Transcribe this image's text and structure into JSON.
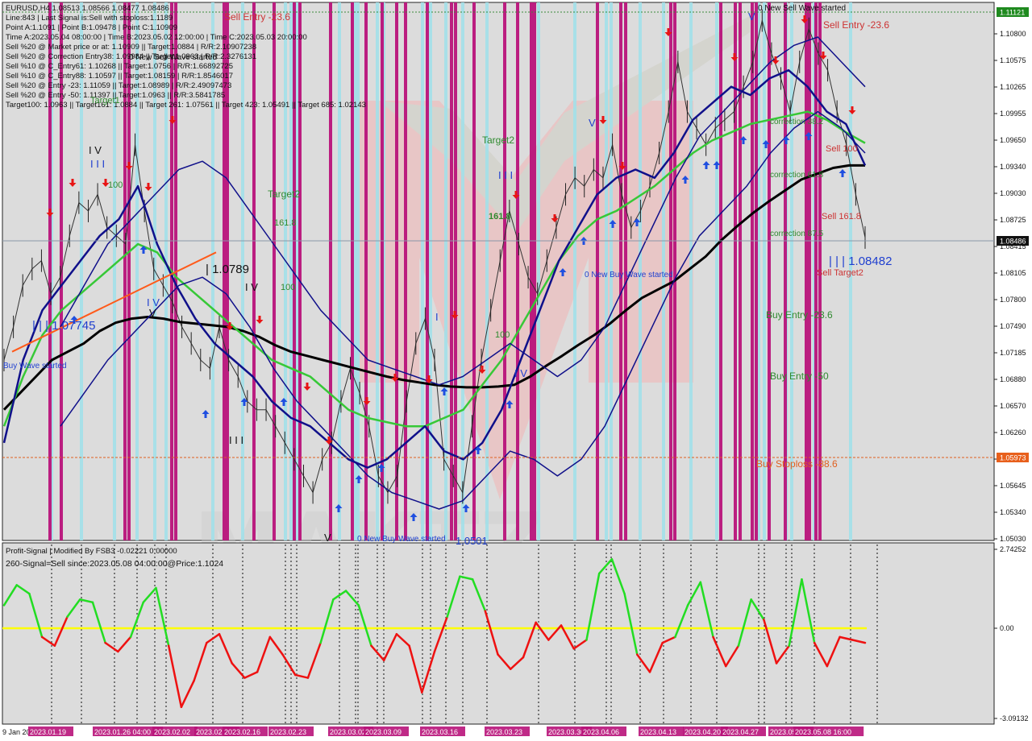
{
  "chart_data": {
    "type": "line",
    "symbol_line": "EURUSD,H4  1.08513 1.08566 1.08477 1.08486",
    "info_lines": [
      "Line:843 | Last Signal is:Sell with stoploss:1.1189",
      "Point A:1.1091 | Point B:1.09478 | Point C:1.10909",
      "Time A:2023.05.04 08:00:00 | Time B:2023.05.02 12:00:00 | Time C:2023.05.03 20:00:00",
      "Sell %20 @ Market price or at: 1.10909 || Target:1.0884 | R/R:2.10907238",
      "Sell %20 @ Correction Entry38: 1.09984 || Target:1.0963 | R/R:2.3276131",
      "Sell %10 @ C_Entry61: 1.10268 || Target:1.0756 | R/R:1.66892725",
      "Sell %10 @ C_Entry88: 1.10597 || Target:1.08159 | R/R:1.8546017",
      "Sell %20 @ Entry -23: 1.11059 || Target:1.08989 | R/R:2.49097473",
      "Sell %20 @ Entry -50: 1.11397 || Target:1.0963 || R/R:3.5841785",
      "Target100: 1.0963 || Target161: 1.0884 || Target 261: 1.07561 || Target 423: 1.05491 || Target 685: 1.02143"
    ],
    "y_ticks": [
      "1.10800",
      "1.10575",
      "1.10265",
      "1.09955",
      "1.09650",
      "1.09340",
      "1.09030",
      "1.08725",
      "1.08415",
      "1.08105",
      "1.07800",
      "1.07490",
      "1.07185",
      "1.06880",
      "1.06570",
      "1.06260",
      "1.05955",
      "1.05645",
      "1.05340",
      "1.05030"
    ],
    "ylim": [
      1.0485,
      1.1127
    ],
    "current_price": "1.08486",
    "top_price": "1.11121",
    "stop_price": "1.05973",
    "indicator": {
      "name": "Profit-Signal | Modified By FSB3 -0.02221 0.00000",
      "signal_text": "260-Signal=Sell since:2023.05.08 04:00:00@Price:1.1024",
      "y_ticks": [
        "2.74252",
        "0.00",
        "-3.09132"
      ],
      "ylim": [
        -3.09132,
        2.74252
      ]
    },
    "x_labels": [
      "9 Jan 2023",
      "2023.01.19",
      "2023.01.26 04:00",
      "2023.02.02",
      "2023.02.09",
      "2023.02.16",
      "2023.02.23",
      "2023.03.02",
      "2023.03.09",
      "2023.03.16",
      "2023.03.23",
      "2023.03.30",
      "2023.04.06",
      "2023.04.13",
      "2023.04.20",
      "2023.04.27",
      "2023.05.04",
      "2023.05.08 16:00"
    ],
    "annotations": {
      "sell_entry_top": "Sell Entry -23.6",
      "sell_entry_right": "Sell Entry -23.6",
      "new_sell_wave_top": "0 New Sell Wave started",
      "new_sell_wave_left": "0 New Sell Wave started",
      "target2_top": "Target2",
      "target2_mid": "Target2",
      "target1_left": "Target1",
      "fib_161_mid": "161.8",
      "fib_100_mid": "100",
      "fib_161_right": "161.8",
      "fib_100_right": "100",
      "fib_100_low": "100",
      "level_1_0789": "| 1.0789",
      "level_1_07745": "| | | 1.07745",
      "level_1_08482": "| | | 1.08482",
      "buy_wave_left": "Buy Wave started",
      "buy_wave_mid": "0 New Buy Wave started",
      "buy_wave_bottom": "0 New Buy Wave started",
      "price_1_0501": "1.0501",
      "correction_38": "correction 38.2",
      "correction_61": "correction 61.8",
      "correction_87": "correction 87.5",
      "sell_100": "Sell 100",
      "sell_161": "Sell 161.8",
      "sell_target2": "Sell Target2",
      "buy_entry_236": "Buy Entry -23.6",
      "buy_entry_50": "Buy Entry -50",
      "buy_stoploss": "Buy Stoploss -88.6",
      "wave_iv_a": "I V",
      "wave_iii_a": "I I I",
      "wave_iv_b": "I V",
      "wave_v_a": "V",
      "wave_iii_b": "I I I",
      "wave_iv_c": "I V",
      "wave_v_b": "V",
      "wave_i": "I",
      "wave_iv_d": "I V",
      "wave_iii_c": "I I I",
      "wave_v_c": "V",
      "wave_v_d": "V"
    },
    "series": [
      {
        "name": "price",
        "values": [
          1.07,
          1.074,
          1.079,
          1.081,
          1.082,
          1.078,
          1.08,
          1.085,
          1.089,
          1.088,
          1.09,
          1.086,
          1.085,
          1.084,
          1.096,
          1.088,
          1.081,
          1.079,
          1.077,
          1.074,
          1.072,
          1.07,
          1.069,
          1.074,
          1.07,
          1.068,
          1.065,
          1.064,
          1.064,
          1.062,
          1.06,
          1.058,
          1.056,
          1.054,
          1.058,
          1.06,
          1.065,
          1.069,
          1.066,
          1.062,
          1.056,
          1.054,
          1.056,
          1.065,
          1.072,
          1.075,
          1.07,
          1.058,
          1.056,
          1.054,
          1.062,
          1.07,
          1.076,
          1.082,
          1.088,
          1.084,
          1.08,
          1.078,
          1.082,
          1.086,
          1.09,
          1.092,
          1.091,
          1.093,
          1.092,
          1.096,
          1.09,
          1.086,
          1.088,
          1.091,
          1.095,
          1.1,
          1.106,
          1.1,
          1.098,
          1.096,
          1.098,
          1.099,
          1.1,
          1.103,
          1.106,
          1.111,
          1.107,
          1.104,
          1.1,
          1.106,
          1.11,
          1.107,
          1.105,
          1.1,
          1.096,
          1.09,
          1.0848
        ]
      },
      {
        "name": "ma_black",
        "values": [
          1.064,
          1.066,
          1.068,
          1.07,
          1.071,
          1.072,
          1.0735,
          1.0745,
          1.075,
          1.0752,
          1.075,
          1.0746,
          1.0744,
          1.0742,
          1.074,
          1.0735,
          1.0728,
          1.0718,
          1.071,
          1.0705,
          1.07,
          1.0695,
          1.069,
          1.0685,
          1.068,
          1.0676,
          1.0673,
          1.067,
          1.0668,
          1.0667,
          1.0667,
          1.0668,
          1.067,
          1.068,
          1.0693,
          1.0705,
          1.0718,
          1.073,
          1.0744,
          1.076,
          1.0775,
          1.0785,
          1.0795,
          1.081,
          1.0825,
          1.0845,
          1.0862,
          1.0878,
          1.0892,
          1.0905,
          1.0918,
          1.0925,
          1.0932,
          1.0935,
          1.0935
        ]
      },
      {
        "name": "ma_green",
        "values": [
          1.062,
          1.068,
          1.073,
          1.076,
          1.078,
          1.08,
          1.082,
          1.084,
          1.083,
          1.08,
          1.078,
          1.076,
          1.074,
          1.072,
          1.07,
          1.069,
          1.068,
          1.066,
          1.064,
          1.063,
          1.0625,
          1.062,
          1.062,
          1.063,
          1.064,
          1.067,
          1.07,
          1.074,
          1.078,
          1.082,
          1.085,
          1.087,
          1.088,
          1.0895,
          1.091,
          1.093,
          1.095,
          1.0965,
          1.0975,
          1.0985,
          1.099,
          1.0995,
          1.1,
          1.099,
          1.0975,
          1.0962
        ]
      },
      {
        "name": "ma_navy",
        "values": [
          1.06,
          1.07,
          1.076,
          1.079,
          1.082,
          1.085,
          1.087,
          1.091,
          1.084,
          1.079,
          1.075,
          1.072,
          1.07,
          1.068,
          1.065,
          1.063,
          1.062,
          1.06,
          1.058,
          1.057,
          1.058,
          1.06,
          1.062,
          1.059,
          1.058,
          1.06,
          1.064,
          1.07,
          1.076,
          1.082,
          1.086,
          1.09,
          1.092,
          1.093,
          1.092,
          1.095,
          1.099,
          1.101,
          1.103,
          1.102,
          1.104,
          1.105,
          1.103,
          1.1,
          1.0985,
          1.0935
        ]
      },
      {
        "name": "band_upper",
        "values": [
          1.074,
          1.079,
          1.084,
          1.087,
          1.09,
          1.093,
          1.094,
          1.092,
          1.088,
          1.084,
          1.08,
          1.076,
          1.073,
          1.07,
          1.069,
          1.068,
          1.067,
          1.068,
          1.07,
          1.072,
          1.07,
          1.068,
          1.07,
          1.074,
          1.08,
          1.086,
          1.092,
          1.097,
          1.1,
          1.103,
          1.106,
          1.108,
          1.109,
          1.106,
          1.103
        ]
      },
      {
        "name": "band_lower",
        "values": [
          1.062,
          1.066,
          1.07,
          1.073,
          1.076,
          1.079,
          1.08,
          1.078,
          1.074,
          1.069,
          1.065,
          1.062,
          1.059,
          1.056,
          1.054,
          1.053,
          1.052,
          1.053,
          1.056,
          1.059,
          1.058,
          1.056,
          1.058,
          1.062,
          1.068,
          1.074,
          1.08,
          1.085,
          1.088,
          1.091,
          1.095,
          1.098,
          1.1,
          1.098,
          1.095
        ]
      },
      {
        "name": "trend_orange",
        "values": [
          1.071,
          1.083
        ]
      },
      {
        "name": "oscillator",
        "values": [
          0.8,
          1.5,
          1.2,
          -0.3,
          -0.6,
          0.4,
          1.0,
          0.9,
          -0.5,
          -0.8,
          -0.3,
          0.9,
          1.4,
          -0.6,
          -2.7,
          -1.8,
          -0.5,
          -0.2,
          -1.2,
          -1.7,
          -1.5,
          -0.3,
          -0.9,
          -1.6,
          -1.7,
          -0.5,
          1.0,
          1.3,
          0.8,
          -0.6,
          -1.1,
          -0.2,
          -0.6,
          -2.2,
          -0.8,
          0.4,
          1.8,
          1.7,
          0.6,
          -0.9,
          -1.4,
          -1.0,
          0.2,
          -0.4,
          0.1,
          -0.7,
          -0.4,
          1.9,
          2.4,
          1.2,
          -0.9,
          -1.5,
          -0.5,
          -0.3,
          0.8,
          1.6,
          -0.3,
          -1.3,
          -0.6,
          1.0,
          0.3,
          -1.2,
          -0.6,
          1.7,
          -0.5,
          -1.3,
          -0.3,
          -0.4,
          -0.5
        ]
      }
    ]
  }
}
